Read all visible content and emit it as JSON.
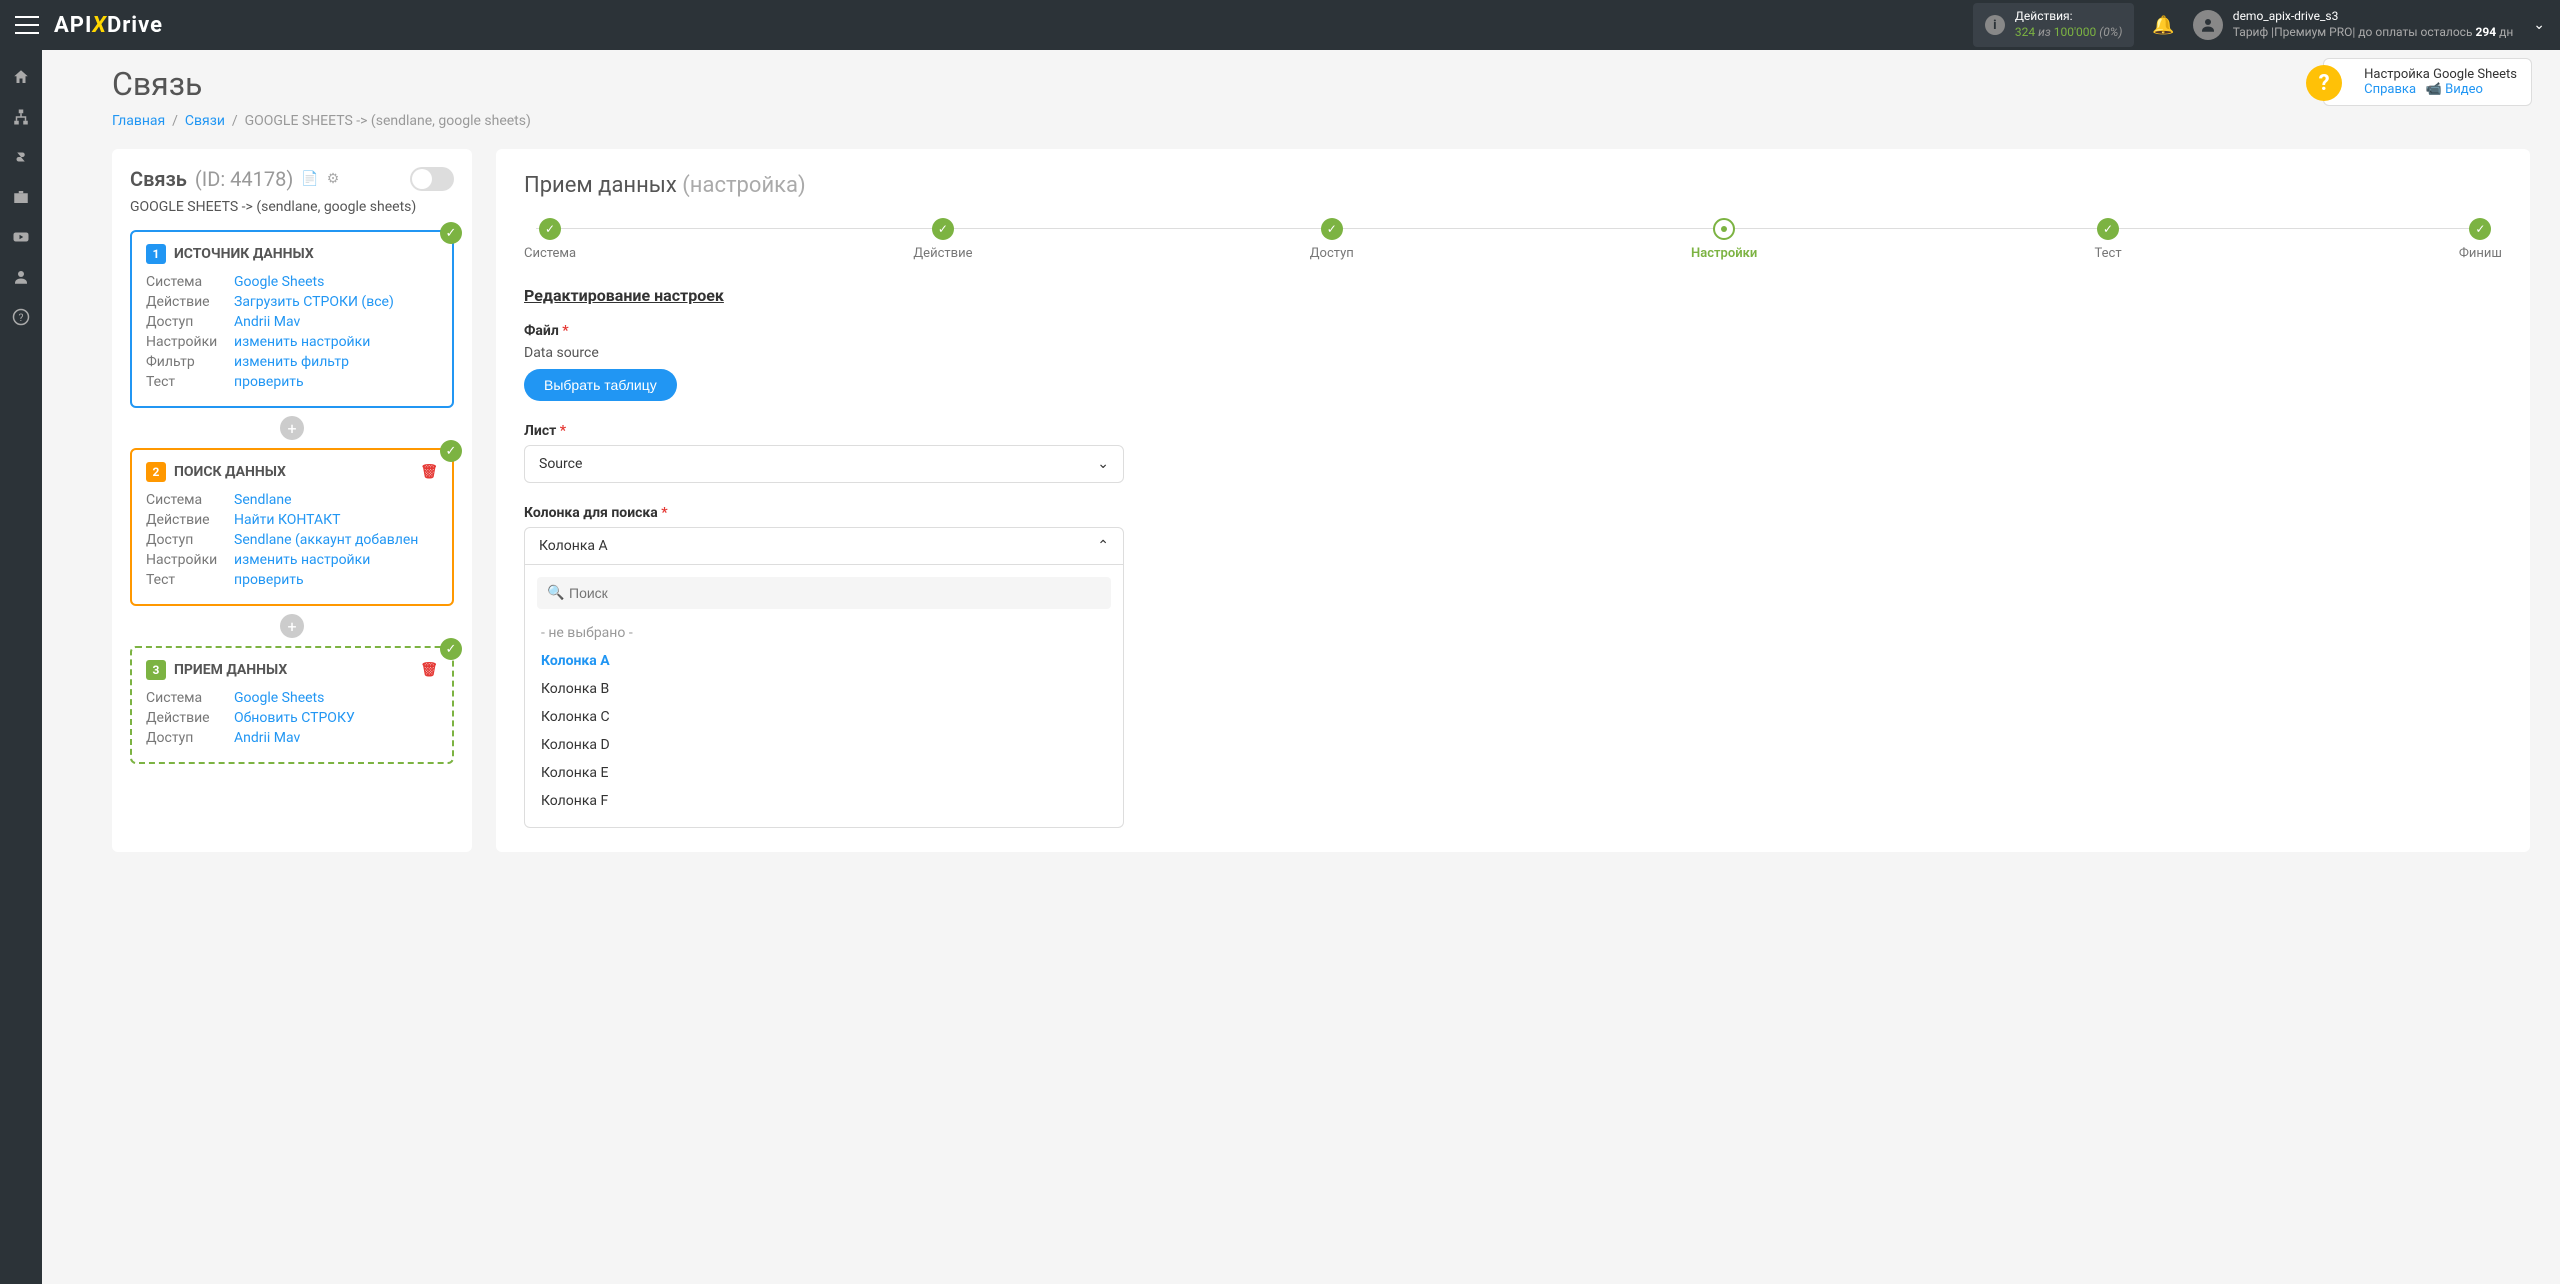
{
  "topbar": {
    "logo_pre": "API",
    "logo_x": "X",
    "logo_post": "Drive",
    "actions_label": "Действия:",
    "actions_used": "324",
    "actions_of": "из",
    "actions_total": "100'000",
    "actions_pct": "(0%)",
    "username": "demo_apix-drive_s3",
    "tariff_label": "Тариф |",
    "tariff_name": "Премиум PRO",
    "tariff_rest": "| до оплаты осталось",
    "tariff_days": "294",
    "tariff_days_unit": "дн"
  },
  "page": {
    "title": "Связь",
    "crumb_home": "Главная",
    "crumb_links": "Связи",
    "crumb_current": "GOOGLE SHEETS -> (sendlane, google sheets)"
  },
  "help": {
    "title": "Настройка Google Sheets",
    "link1": "Справка",
    "link2": "Видео"
  },
  "conn": {
    "title": "Связь",
    "id": "(ID: 44178)",
    "sub": "GOOGLE SHEETS -> (sendlane, google sheets)"
  },
  "cards": [
    {
      "num": "1",
      "title": "ИСТОЧНИК ДАННЫХ",
      "rows": [
        {
          "lbl": "Система",
          "val": "Google Sheets"
        },
        {
          "lbl": "Действие",
          "val": "Загрузить СТРОКИ (все)"
        },
        {
          "lbl": "Доступ",
          "val": "Andrii Mav"
        },
        {
          "lbl": "Настройки",
          "val": "изменить настройки"
        },
        {
          "lbl": "Фильтр",
          "val": "изменить фильтр"
        },
        {
          "lbl": "Тест",
          "val": "проверить"
        }
      ]
    },
    {
      "num": "2",
      "title": "ПОИСК ДАННЫХ",
      "rows": [
        {
          "lbl": "Система",
          "val": "Sendlane"
        },
        {
          "lbl": "Действие",
          "val": "Найти КОНТАКТ"
        },
        {
          "lbl": "Доступ",
          "val": "Sendlane (аккаунт добавлен"
        },
        {
          "lbl": "Настройки",
          "val": "изменить настройки"
        },
        {
          "lbl": "Тест",
          "val": "проверить"
        }
      ]
    },
    {
      "num": "3",
      "title": "ПРИЕМ ДАННЫХ",
      "rows": [
        {
          "lbl": "Система",
          "val": "Google Sheets"
        },
        {
          "lbl": "Действие",
          "val": "Обновить СТРОКУ"
        },
        {
          "lbl": "Доступ",
          "val": "Andrii Mav"
        }
      ]
    }
  ],
  "right": {
    "title_main": "Прием данных",
    "title_sub": "(настройка)",
    "steps": [
      "Система",
      "Действие",
      "Доступ",
      "Настройки",
      "Тест",
      "Финиш"
    ],
    "active_step": 3,
    "section": "Редактирование настроек",
    "file_label": "Файл",
    "file_value": "Data source",
    "file_btn": "Выбрать таблицу",
    "sheet_label": "Лист",
    "sheet_value": "Source",
    "col_label": "Колонка для поиска",
    "col_value": "Колонка A",
    "search_placeholder": "Поиск",
    "options": [
      "- не выбрано -",
      "Колонка A",
      "Колонка B",
      "Колонка C",
      "Колонка D",
      "Колонка E",
      "Колонка F"
    ]
  }
}
